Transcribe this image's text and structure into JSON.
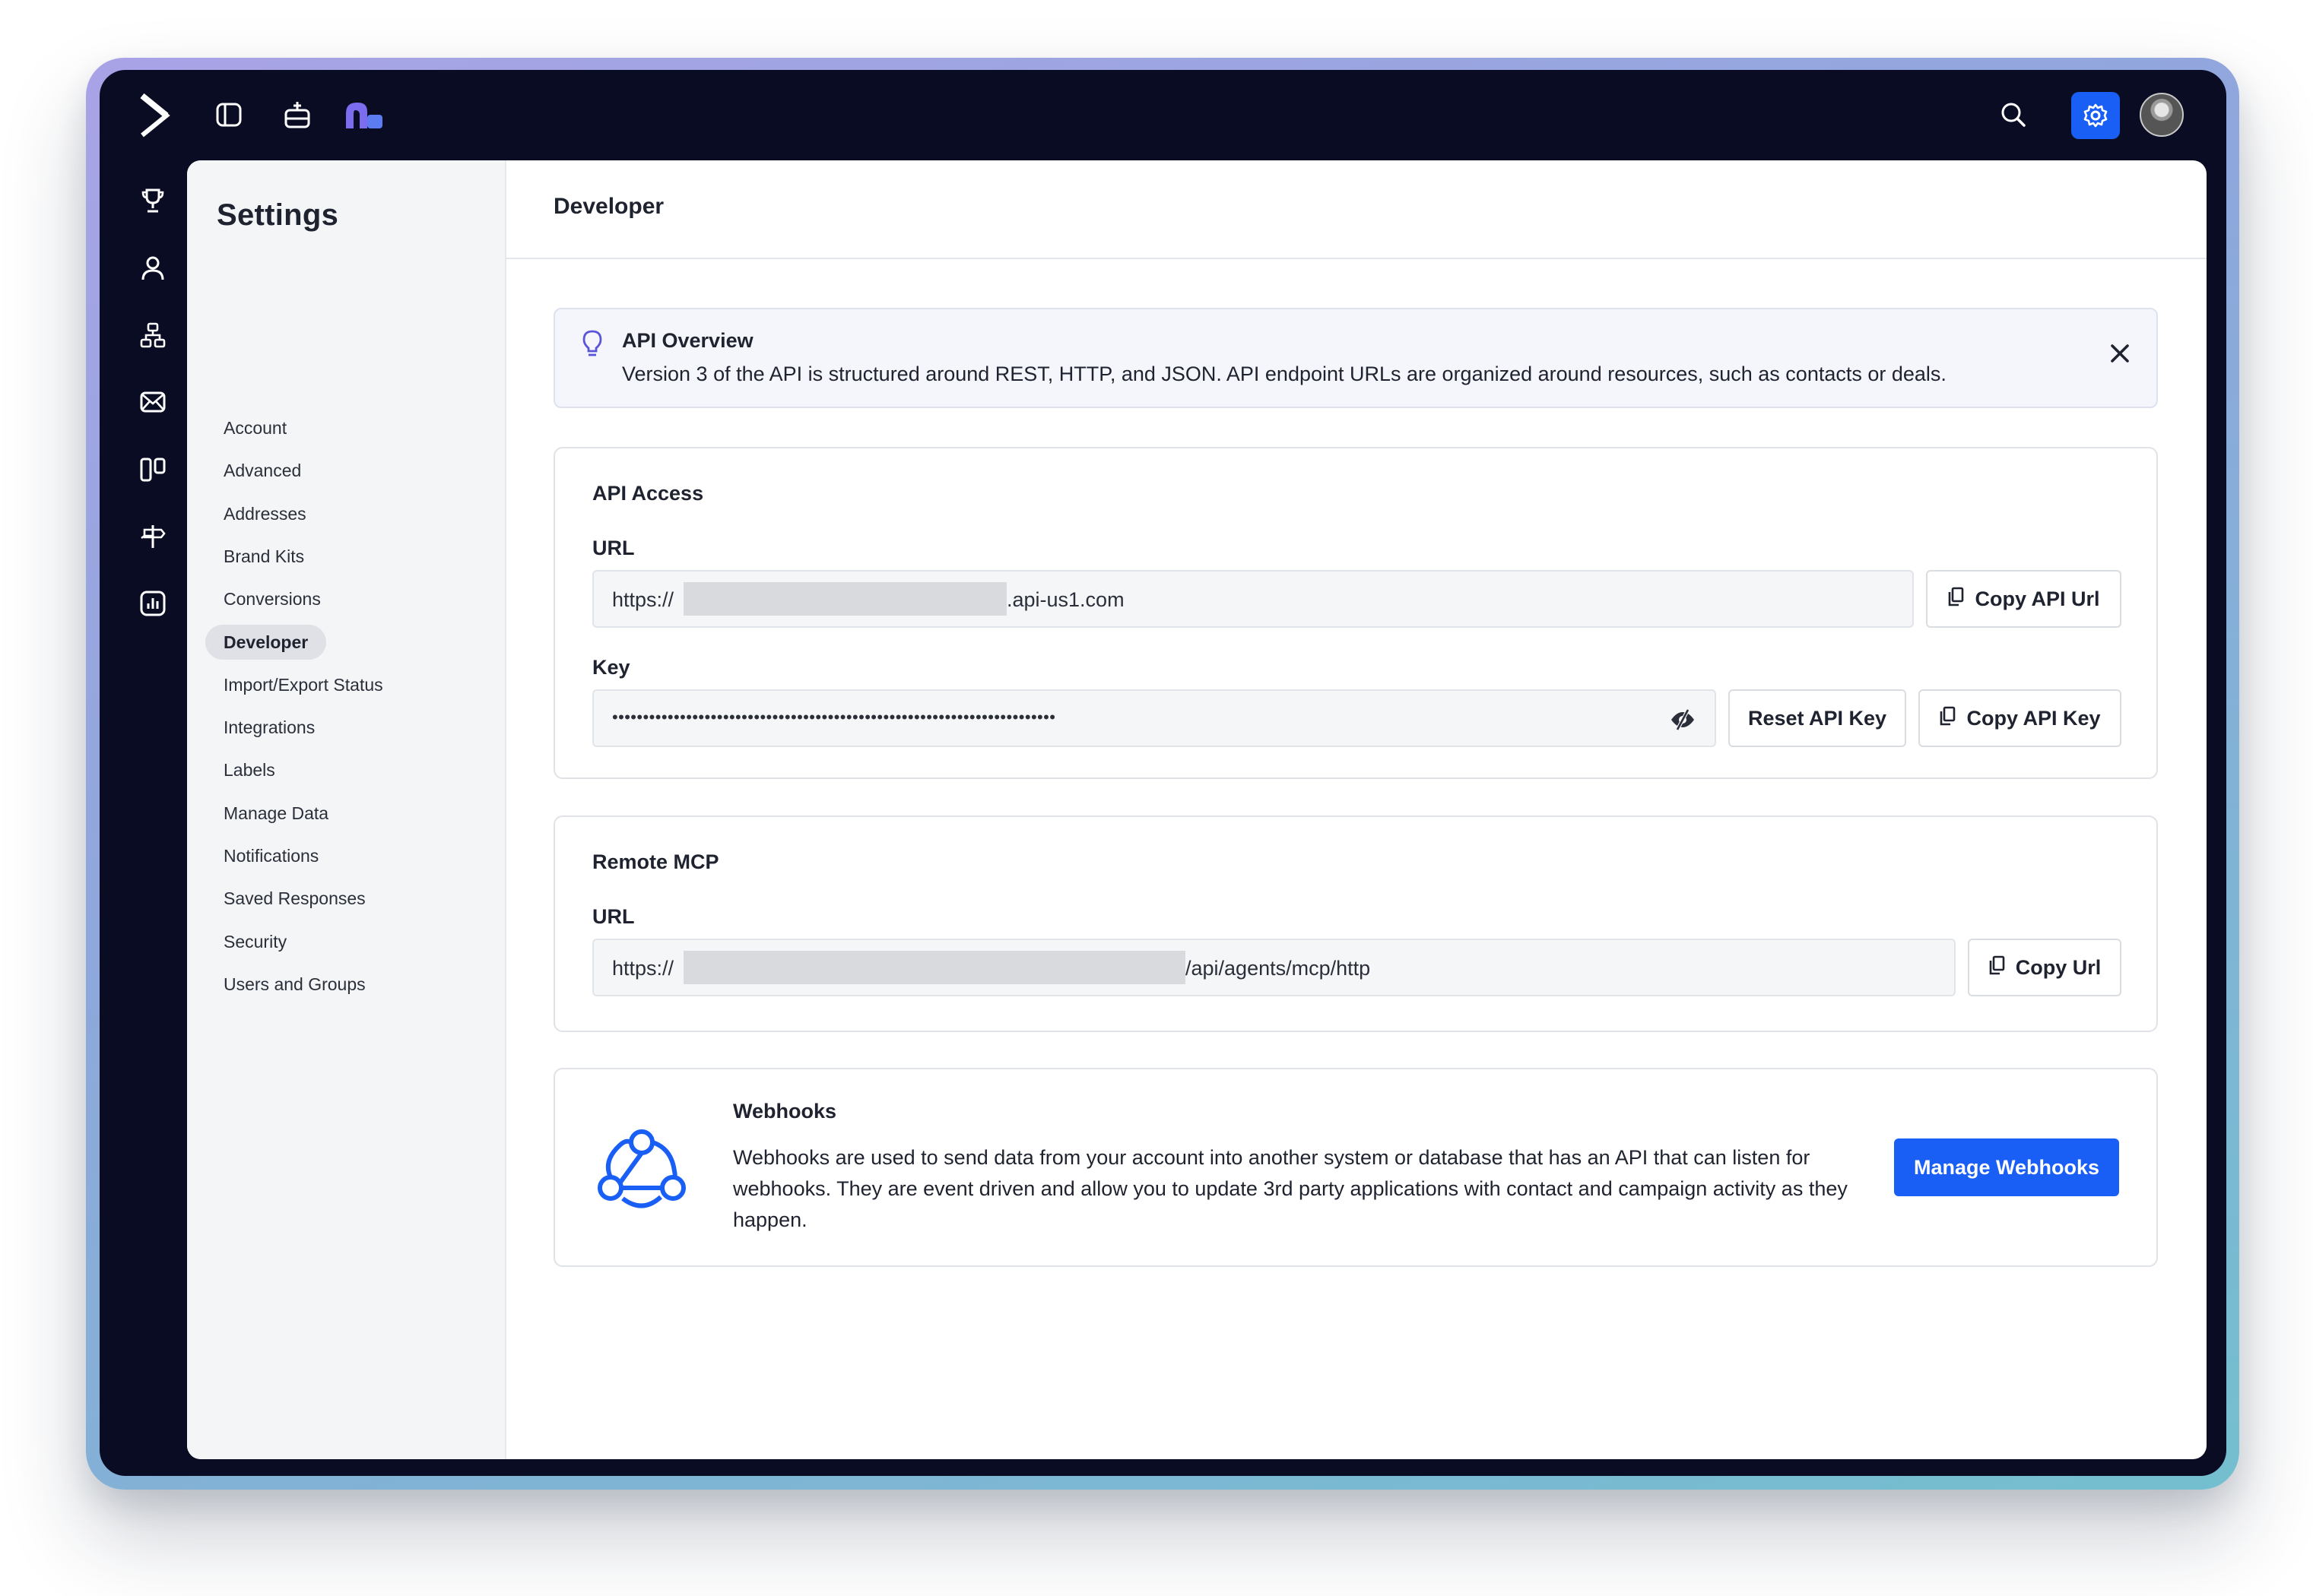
{
  "colors": {
    "app_bg": "#0a0c24",
    "accent": "#1a5ff5",
    "brand_purple": "#7b6cf0",
    "active_nav_bg": "#dfe1e6"
  },
  "topbar": {
    "logo_icon": "chevron-right-logo",
    "icons": [
      "sidebar-toggle-icon",
      "inbox-icon",
      "app-logo-icon"
    ],
    "right_icons": [
      "search-icon",
      "gear-icon",
      "avatar"
    ]
  },
  "rail": {
    "icons": [
      "trophy-icon",
      "contacts-icon",
      "automations-icon",
      "email-icon",
      "pipeline-icon",
      "signpost-icon",
      "reports-icon"
    ]
  },
  "settings": {
    "title": "Settings",
    "items": [
      {
        "label": "Account"
      },
      {
        "label": "Advanced"
      },
      {
        "label": "Addresses"
      },
      {
        "label": "Brand Kits"
      },
      {
        "label": "Conversions"
      },
      {
        "label": "Developer",
        "active": true
      },
      {
        "label": "Import/Export Status"
      },
      {
        "label": "Integrations"
      },
      {
        "label": "Labels"
      },
      {
        "label": "Manage Data"
      },
      {
        "label": "Notifications"
      },
      {
        "label": "Saved Responses"
      },
      {
        "label": "Security"
      },
      {
        "label": "Users and Groups"
      }
    ]
  },
  "page": {
    "title": "Developer"
  },
  "banner": {
    "title": "API Overview",
    "text": "Version 3 of the API is structured around REST, HTTP, and JSON. API endpoint URLs are organized around resources, such as contacts or deals."
  },
  "api_access": {
    "title": "API Access",
    "url_label": "URL",
    "url_prefix": "https://",
    "url_suffix": ".api-us1.com",
    "copy_url_label": "Copy API Url",
    "key_label": "Key",
    "key_masked": "••••••••••••••••••••••••••••••••••••••••••••••••••••••••••••••••••••••••",
    "reset_key_label": "Reset API Key",
    "copy_key_label": "Copy API Key"
  },
  "remote_mcp": {
    "title": "Remote MCP",
    "url_label": "URL",
    "url_prefix": "https://",
    "url_suffix": "/api/agents/mcp/http",
    "copy_url_label": "Copy Url"
  },
  "webhooks": {
    "title": "Webhooks",
    "text": "Webhooks are used to send data from your account into another system or database that has an API that can listen for webhooks. They are event driven and allow you to update 3rd party applications with contact and campaign activity as they happen.",
    "button_label": "Manage Webhooks"
  }
}
